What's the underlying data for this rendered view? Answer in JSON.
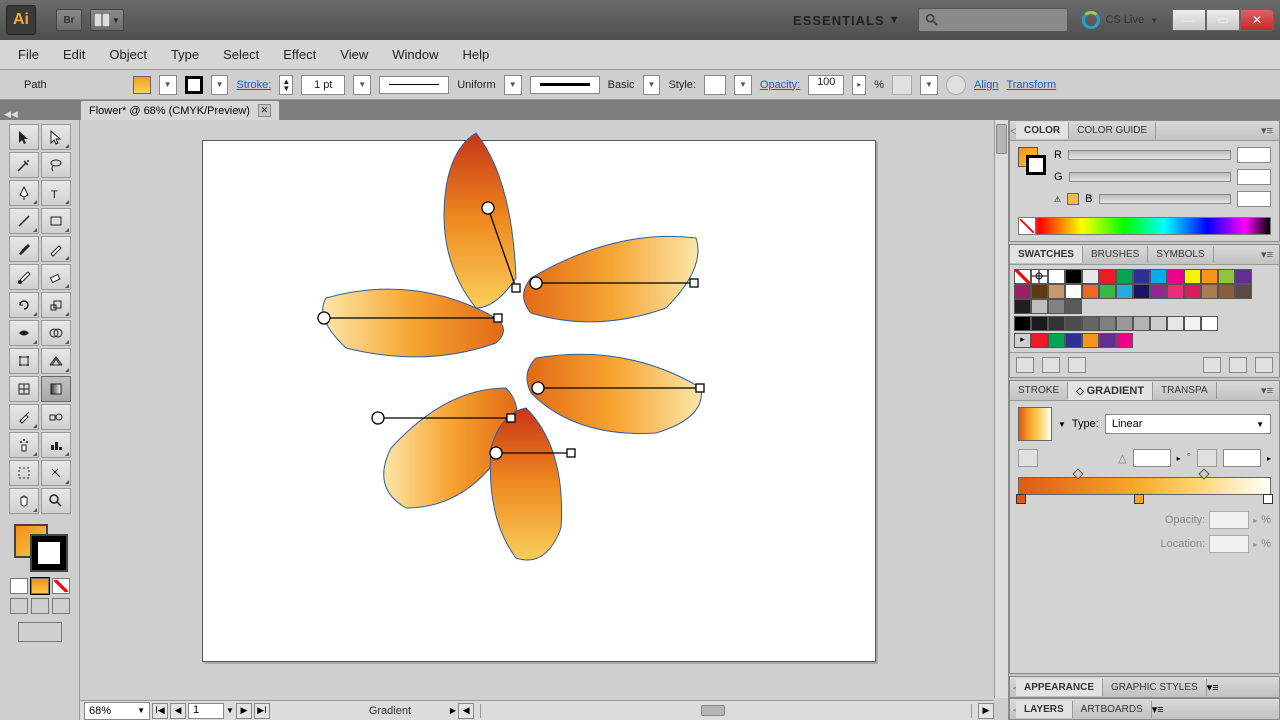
{
  "app": {
    "logo": "Ai",
    "bridge": "Br"
  },
  "workspace": {
    "label": "ESSENTIALS"
  },
  "cslive": {
    "label": "CS Live"
  },
  "menu": {
    "items": [
      "File",
      "Edit",
      "Object",
      "Type",
      "Select",
      "Effect",
      "View",
      "Window",
      "Help"
    ]
  },
  "control": {
    "selection": "Path",
    "stroke_label": "Stroke:",
    "stroke_weight": "1 pt",
    "var_width": "Uniform",
    "brush": "Basic",
    "style_label": "Style:",
    "opacity_label": "Opacity:",
    "opacity_value": "100",
    "percent": "%",
    "align": "Align",
    "transform": "Transform"
  },
  "document": {
    "tab": "Flower* @ 68% (CMYK/Preview)"
  },
  "status": {
    "zoom": "68%",
    "page": "1",
    "tool": "Gradient"
  },
  "panels": {
    "color": {
      "tabs": [
        "COLOR",
        "COLOR GUIDE"
      ],
      "channels": [
        "R",
        "G",
        "B"
      ]
    },
    "swatches": {
      "tabs": [
        "SWATCHES",
        "BRUSHES",
        "SYMBOLS"
      ],
      "colors": [
        "#ffffff",
        "#000000",
        "#e8e8e8",
        "#ed1c24",
        "#00a651",
        "#2e3192",
        "#00aeef",
        "#ec008c",
        "#fff200",
        "#f7941d",
        "#8dc63e",
        "#662d91",
        "#9e1f63",
        "#603913",
        "#c49a6c",
        "#ffffff",
        "#f26522",
        "#39b54a",
        "#27aae1",
        "#1b1464",
        "#92278f",
        "#ee2a7b",
        "#da1c5c",
        "#a97c50",
        "#8b5e3c",
        "#594a42",
        "#231f20",
        "#bcbec0",
        "#808285",
        "#58595b"
      ],
      "grays": [
        "#000000",
        "#1a1a1a",
        "#333333",
        "#4d4d4d",
        "#666666",
        "#808080",
        "#999999",
        "#b3b3b3",
        "#cccccc",
        "#e6e6e6",
        "#f2f2f2",
        "#ffffff"
      ],
      "libs": [
        "#ed1c24",
        "#00a651",
        "#2e3192",
        "#f7941d",
        "#662d91",
        "#ec008c"
      ]
    },
    "gradient": {
      "tabs": [
        "STROKE",
        "GRADIENT",
        "TRANSPA"
      ],
      "type_label": "Type:",
      "type_value": "Linear",
      "opacity_label": "Opacity:",
      "location_label": "Location:",
      "percent": "%"
    },
    "appearance": {
      "tabs": [
        "APPEARANCE",
        "GRAPHIC STYLES"
      ]
    },
    "layers": {
      "tabs": [
        "LAYERS",
        "ARTBOARDS"
      ]
    }
  }
}
